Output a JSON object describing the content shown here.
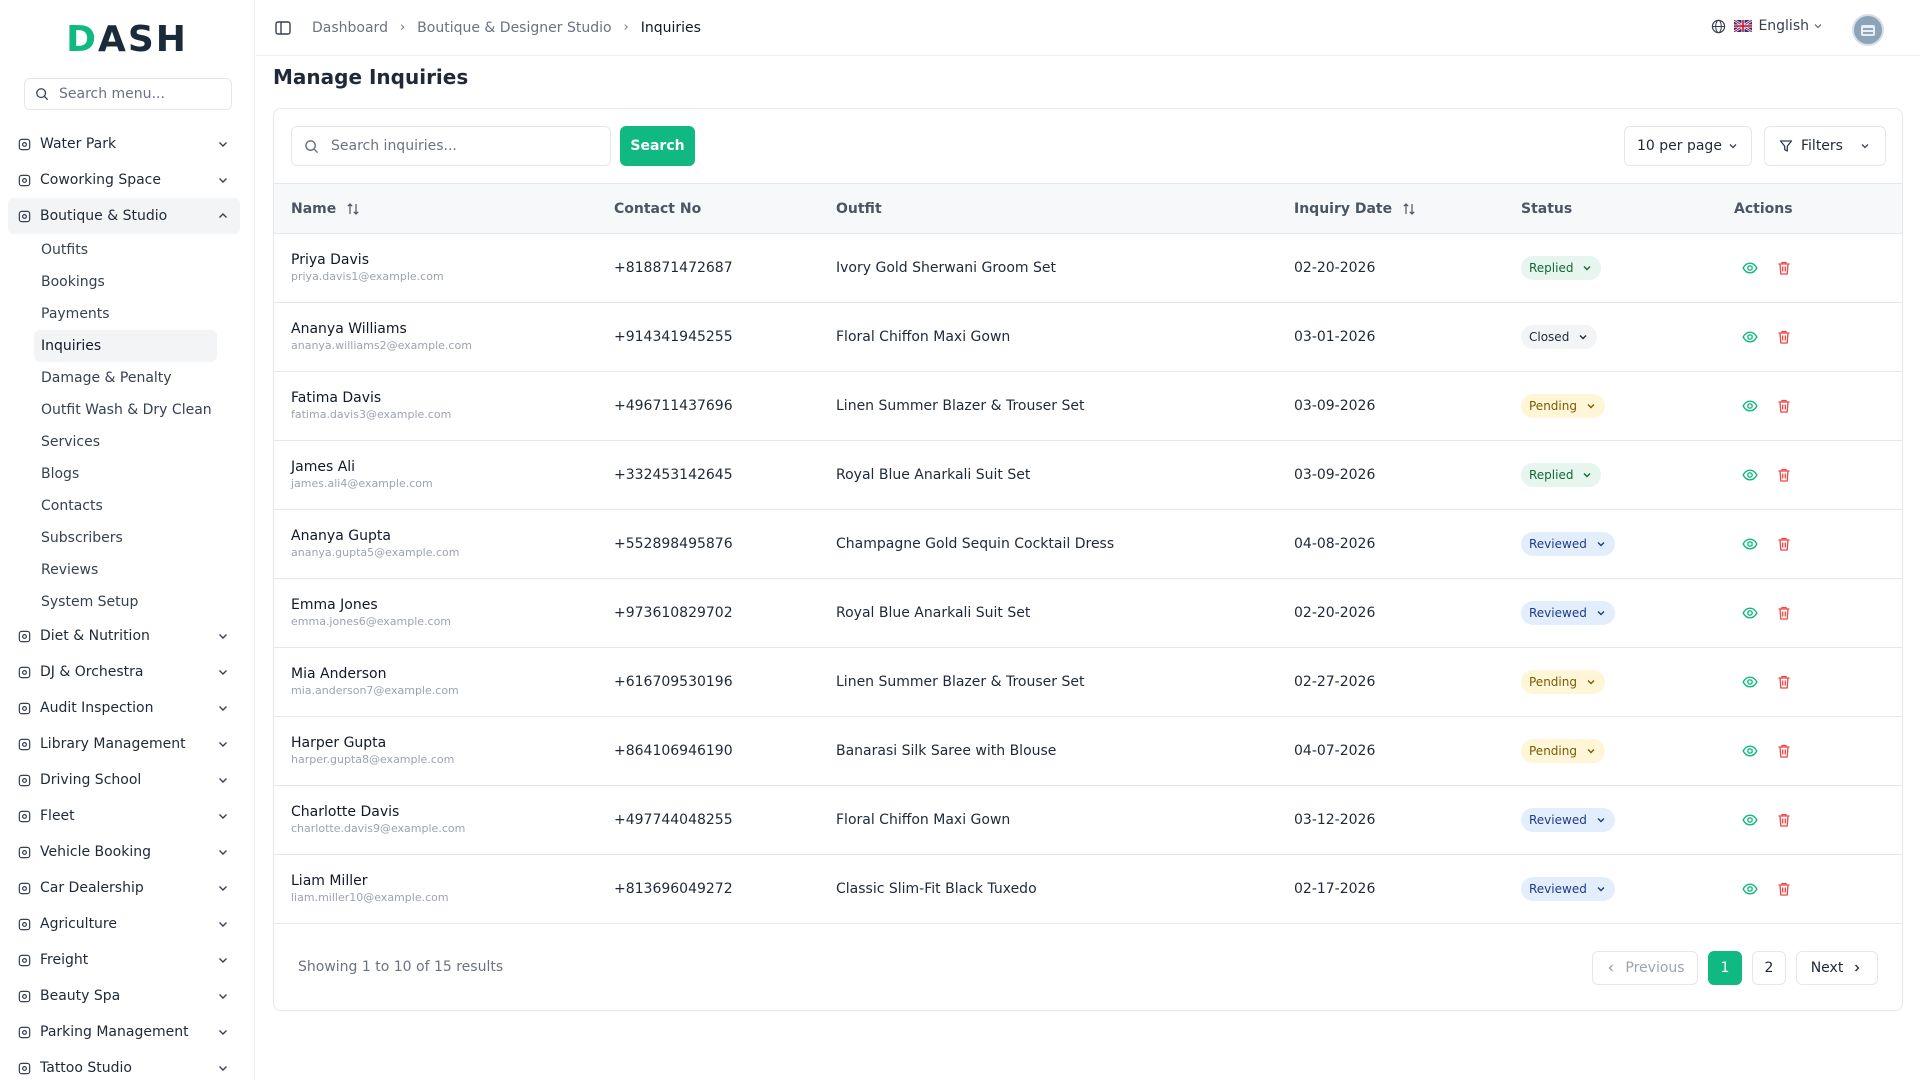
{
  "brand": {
    "logo_text_start": "D",
    "logo_text_rest": "ASH"
  },
  "sidebar": {
    "search_placeholder": "Search menu...",
    "top_items": [
      {
        "label": "Water Park",
        "icon": "waves-icon"
      },
      {
        "label": "Coworking Space",
        "icon": "wifi-icon"
      },
      {
        "label": "Boutique & Studio",
        "icon": "shirt-icon"
      }
    ],
    "sub_items": [
      {
        "label": "Outfits"
      },
      {
        "label": "Bookings"
      },
      {
        "label": "Payments"
      },
      {
        "label": "Inquiries"
      },
      {
        "label": "Damage & Penalty"
      },
      {
        "label": "Outfit Wash & Dry Clean"
      },
      {
        "label": "Services"
      },
      {
        "label": "Blogs"
      },
      {
        "label": "Contacts"
      },
      {
        "label": "Subscribers"
      },
      {
        "label": "Reviews"
      },
      {
        "label": "System Setup"
      }
    ],
    "bottom_items": [
      {
        "label": "Diet & Nutrition",
        "icon": "salad-icon"
      },
      {
        "label": "DJ & Orchestra",
        "icon": "disc-icon"
      },
      {
        "label": "Audit Inspection",
        "icon": "search-zoom-icon"
      },
      {
        "label": "Library Management",
        "icon": "library-icon"
      },
      {
        "label": "Driving School",
        "icon": "steering-wheel-icon"
      },
      {
        "label": "Fleet",
        "icon": "bus-icon"
      },
      {
        "label": "Vehicle Booking",
        "icon": "car-front-icon"
      },
      {
        "label": "Car Dealership",
        "icon": "car-icon"
      },
      {
        "label": "Agriculture",
        "icon": "tractor-icon"
      },
      {
        "label": "Freight",
        "icon": "truck-icon"
      },
      {
        "label": "Beauty Spa",
        "icon": "scissors-icon"
      },
      {
        "label": "Parking Management",
        "icon": "grid-icon"
      },
      {
        "label": "Tattoo Studio",
        "icon": "pen-icon"
      }
    ]
  },
  "header": {
    "breadcrumbs": [
      "Dashboard",
      "Boutique & Designer Studio",
      "Inquiries"
    ],
    "language": "English"
  },
  "page": {
    "title": "Manage Inquiries",
    "search_placeholder": "Search inquiries...",
    "search_button": "Search",
    "per_page": "10 per page",
    "filters_label": "Filters"
  },
  "table": {
    "columns": [
      "Name",
      "Contact No",
      "Outfit",
      "Inquiry Date",
      "Status",
      "Actions"
    ],
    "rows": [
      {
        "name": "Priya Davis",
        "email": "priya.davis1@example.com",
        "contact": "+818871472687",
        "outfit": "Ivory Gold Sherwani Groom Set",
        "date": "02-20-2026",
        "status": "Replied"
      },
      {
        "name": "Ananya Williams",
        "email": "ananya.williams2@example.com",
        "contact": "+914341945255",
        "outfit": "Floral Chiffon Maxi Gown",
        "date": "03-01-2026",
        "status": "Closed"
      },
      {
        "name": "Fatima Davis",
        "email": "fatima.davis3@example.com",
        "contact": "+496711437696",
        "outfit": "Linen Summer Blazer & Trouser Set",
        "date": "03-09-2026",
        "status": "Pending"
      },
      {
        "name": "James Ali",
        "email": "james.ali4@example.com",
        "contact": "+332453142645",
        "outfit": "Royal Blue Anarkali Suit Set",
        "date": "03-09-2026",
        "status": "Replied"
      },
      {
        "name": "Ananya Gupta",
        "email": "ananya.gupta5@example.com",
        "contact": "+552898495876",
        "outfit": "Champagne Gold Sequin Cocktail Dress",
        "date": "04-08-2026",
        "status": "Reviewed"
      },
      {
        "name": "Emma Jones",
        "email": "emma.jones6@example.com",
        "contact": "+973610829702",
        "outfit": "Royal Blue Anarkali Suit Set",
        "date": "02-20-2026",
        "status": "Reviewed"
      },
      {
        "name": "Mia Anderson",
        "email": "mia.anderson7@example.com",
        "contact": "+616709530196",
        "outfit": "Linen Summer Blazer & Trouser Set",
        "date": "02-27-2026",
        "status": "Pending"
      },
      {
        "name": "Harper Gupta",
        "email": "harper.gupta8@example.com",
        "contact": "+864106946190",
        "outfit": "Banarasi Silk Saree with Blouse",
        "date": "04-07-2026",
        "status": "Pending"
      },
      {
        "name": "Charlotte Davis",
        "email": "charlotte.davis9@example.com",
        "contact": "+497744048255",
        "outfit": "Floral Chiffon Maxi Gown",
        "date": "03-12-2026",
        "status": "Reviewed"
      },
      {
        "name": "Liam Miller",
        "email": "liam.miller10@example.com",
        "contact": "+813696049272",
        "outfit": "Classic Slim-Fit Black Tuxedo",
        "date": "02-17-2026",
        "status": "Reviewed"
      }
    ]
  },
  "pagination": {
    "summary": "Showing 1 to 10 of 15 results",
    "previous": "Previous",
    "next": "Next",
    "pages": [
      "1",
      "2"
    ]
  },
  "colors": {
    "accent": "#10b981",
    "view": "#10b981",
    "delete": "#ef4444"
  }
}
